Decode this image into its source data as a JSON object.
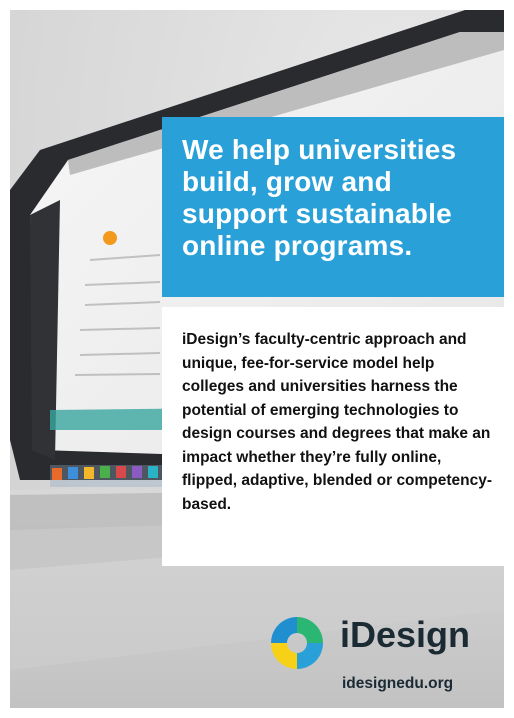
{
  "headline": "We help universities build, grow and support sustainable online programs.",
  "body": "iDesign’s faculty-centric approach and unique, fee-for-service model help colleges and universities harness the potential of emerging technologies to design courses and degrees that make an impact whether they’re fully online, flipped, adaptive, blended or competency-based.",
  "brand": {
    "name": "iDesign",
    "url": "idesignedu.org",
    "logo_icon": "idesign-ring-logo-icon",
    "colors": {
      "blue": "#2aa0d8",
      "green": "#2bb673",
      "yellow": "#f7d117",
      "navy": "#1b2b34"
    }
  },
  "photo_icon": "laptop-photo-icon"
}
